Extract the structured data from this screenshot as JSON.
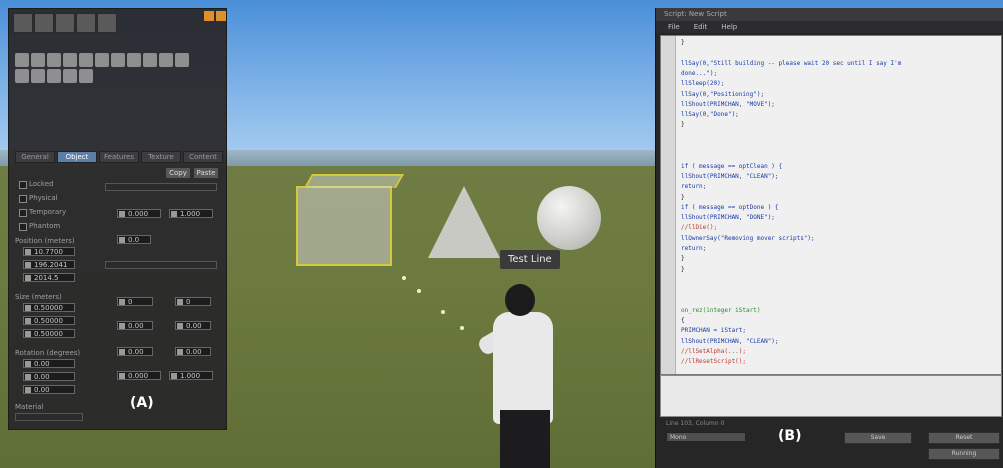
{
  "figure_labels": {
    "a": "(A)",
    "b": "(B)"
  },
  "scene": {
    "tooltip": "Test Line"
  },
  "colors": {
    "selection": "#d4c93a",
    "sky": "#4a8fd8",
    "ground": "#6c7a3f",
    "panel_bg": "#28282a",
    "editor_bg": "#f0f0f0"
  },
  "panel_a": {
    "top_icons": [
      "camera-icon",
      "move-icon",
      "rotate-icon",
      "scale-icon",
      "create-icon"
    ],
    "tabs": [
      "General",
      "Object",
      "Features",
      "Texture",
      "Content"
    ],
    "active_tab": "Object",
    "checkboxes": [
      "Locked",
      "Physical",
      "Temporary",
      "Phantom"
    ],
    "position_label": "Position (meters)",
    "position": [
      "10.7700",
      "196.2041",
      "2014.5"
    ],
    "size_label": "Size (meters)",
    "size": [
      "0.50000",
      "0.50000",
      "0.50000"
    ],
    "rotation_label": "Rotation (degrees)",
    "rotation": [
      "0.00",
      "0.00",
      "0.00"
    ],
    "material_label": "Material",
    "buttons": [
      "Copy",
      "Paste"
    ],
    "right_fields": {
      "path_cut_begin": "0.000",
      "path_cut_end": "1.000",
      "hollow": "0.0",
      "twist_begin": "0",
      "twist_end": "0",
      "taper_x": "0.00",
      "taper_y": "0.00",
      "top_shear_x": "0.00",
      "top_shear_y": "0.00",
      "slice_begin": "0.000",
      "slice_end": "1.000"
    }
  },
  "panel_b": {
    "title": "Script: New Script",
    "menu": [
      "File",
      "Edit",
      "Help"
    ],
    "code": [
      {
        "text": "}",
        "color": "black"
      },
      {
        "text": "",
        "color": "black"
      },
      {
        "text": "llSay(0,\"Still building -- please wait 20 sec until I say I'm",
        "color": "blue"
      },
      {
        "text": "done...\");",
        "color": "blue"
      },
      {
        "text": "llSleep(20);",
        "color": "blue"
      },
      {
        "text": "llSay(0,\"Positioning\");",
        "color": "blue"
      },
      {
        "text": "llShout(PRIMCHAN, \"MOVE\");",
        "color": "blue"
      },
      {
        "text": "llSay(0,\"Done\");",
        "color": "blue"
      },
      {
        "text": "}",
        "color": "black"
      },
      {
        "text": "",
        "color": "black"
      },
      {
        "text": "",
        "color": "black"
      },
      {
        "text": "",
        "color": "black"
      },
      {
        "text": "if ( message == optClean ) {",
        "color": "blue"
      },
      {
        "text": "llShout(PRIMCHAN, \"CLEAN\");",
        "color": "blue"
      },
      {
        "text": "return;",
        "color": "blue"
      },
      {
        "text": "}",
        "color": "black"
      },
      {
        "text": "if ( message == optDone ) {",
        "color": "blue"
      },
      {
        "text": "llShout(PRIMCHAN, \"DONE\");",
        "color": "blue"
      },
      {
        "text": "//llDie();",
        "color": "red"
      },
      {
        "text": "llOwnerSay(\"Removing mover scripts\");",
        "color": "blue"
      },
      {
        "text": "return;",
        "color": "blue"
      },
      {
        "text": "}",
        "color": "black"
      },
      {
        "text": "}",
        "color": "black"
      },
      {
        "text": "",
        "color": "black"
      },
      {
        "text": "",
        "color": "black"
      },
      {
        "text": "",
        "color": "black"
      },
      {
        "text": "on_rez(integer iStart)",
        "color": "green"
      },
      {
        "text": "{",
        "color": "black"
      },
      {
        "text": "PRIMCHAN = iStart;",
        "color": "blue"
      },
      {
        "text": "llShout(PRIMCHAN, \"CLEAN\");",
        "color": "blue"
      },
      {
        "text": "//llSetAlpha(...);",
        "color": "red"
      },
      {
        "text": "//llResetScript();",
        "color": "red"
      }
    ],
    "bottom_label": "Line 103, Column 0",
    "bottom_field": "Mono",
    "bottom_buttons": [
      "Save",
      "Reset",
      "Running"
    ]
  }
}
